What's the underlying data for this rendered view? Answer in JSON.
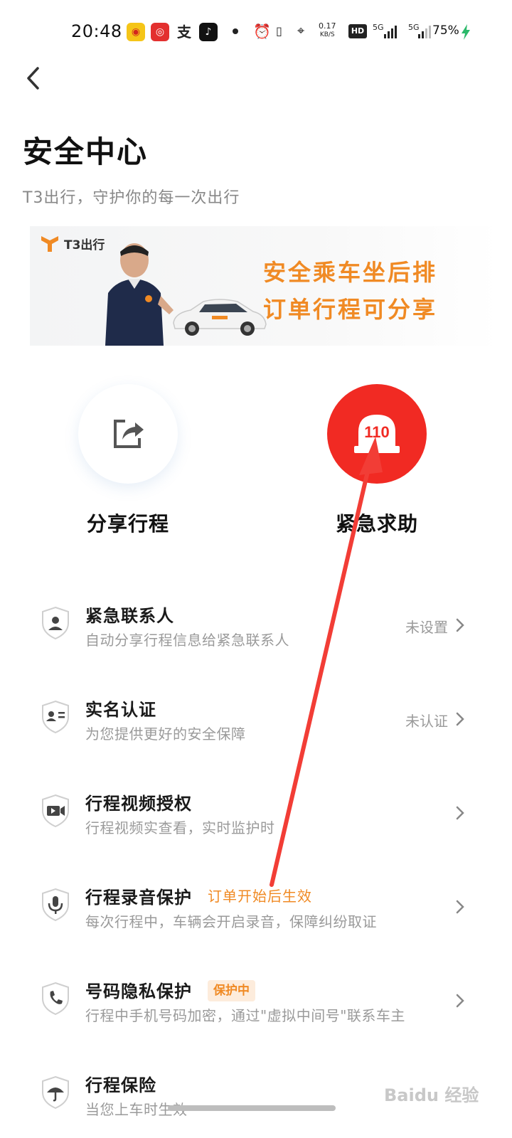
{
  "status_bar": {
    "time": "20:48",
    "net_speed_value": "0.17",
    "net_speed_unit": "KB/S",
    "hd_label": "HD",
    "sim1_label": "5G",
    "sim2_label": "5G",
    "battery": "75%",
    "app_icons": [
      "weibo-icon",
      "netease-music-icon",
      "alipay-icon",
      "tiktok-icon"
    ]
  },
  "header": {
    "title": "安全中心",
    "subtitle": "T3出行，守护你的每一次出行"
  },
  "banner": {
    "logo_text": "T3出行",
    "line1": "安全乘车坐后排",
    "line2": "订单行程可分享",
    "accent_color": "#f08a24"
  },
  "actions": {
    "share_label": "分享行程",
    "sos_label": "紧急求助",
    "sos_badge": "110",
    "sos_color": "#f12a23"
  },
  "list": [
    {
      "title": "紧急联系人",
      "subtitle": "自动分享行程信息给紧急联系人",
      "status": "未设置",
      "icon": "contact-shield-icon"
    },
    {
      "title": "实名认证",
      "subtitle": "为您提供更好的安全保障",
      "status": "未认证",
      "icon": "id-card-shield-icon"
    },
    {
      "title": "行程视频授权",
      "subtitle": "行程视频实查看，实时监护时",
      "status": "",
      "icon": "video-shield-icon"
    },
    {
      "title": "行程录音保护",
      "tag": "订单开始后生效",
      "subtitle": "每次行程中，车辆会开启录音，保障纠纷取证",
      "status": "",
      "icon": "microphone-shield-icon"
    },
    {
      "title": "号码隐私保护",
      "badge": "保护中",
      "subtitle": "行程中手机号码加密，通过\"虚拟中间号\"联系车主",
      "status": "",
      "icon": "phone-shield-icon"
    },
    {
      "title": "行程保险",
      "subtitle": "当您上车时生效",
      "status": "",
      "icon": "umbrella-shield-icon"
    }
  ],
  "watermark": "Baidu 经验"
}
